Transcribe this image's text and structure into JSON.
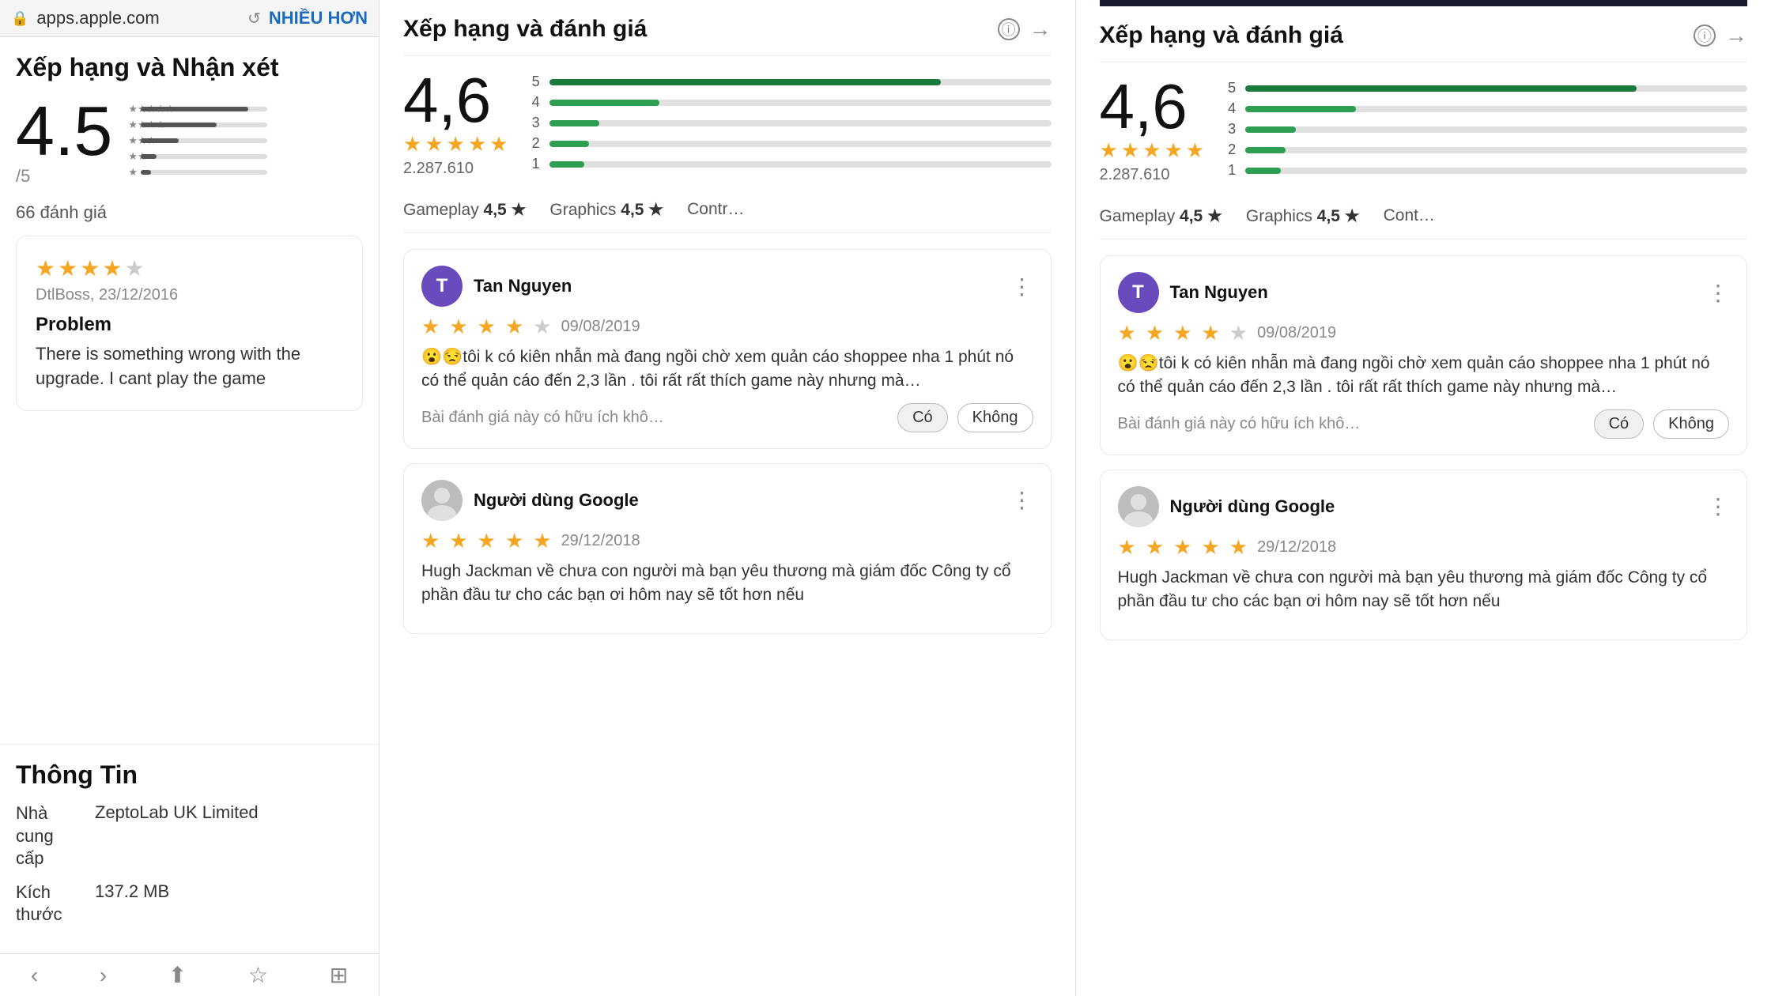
{
  "left": {
    "address_bar": {
      "url": "apps.apple.com",
      "more_btn": "NHIỀU HƠN"
    },
    "ratings_title": "Xếp hạng và Nhận xét",
    "big_rating": "4.5",
    "out_of": "/5",
    "review_count": "66 đánh giá",
    "stars": [
      {
        "level": 5,
        "width_pct": 85
      },
      {
        "level": 4,
        "width_pct": 65
      },
      {
        "level": 3,
        "width_pct": 40
      },
      {
        "level": 2,
        "width_pct": 15
      },
      {
        "level": 1,
        "width_pct": 8
      }
    ],
    "review": {
      "stars": 4,
      "author": "DtlBoss, 23/12/2016",
      "title": "Problem",
      "body": "There is something wrong with the upgrade. I cant play the game"
    },
    "info_section": {
      "title": "Thông Tin",
      "rows": [
        {
          "label": "Nhà cung cấp",
          "value": "ZeptoLab UK Limited"
        },
        {
          "label": "Kích thước",
          "value": "137.2 MB"
        }
      ]
    }
  },
  "middle": {
    "header_title": "Xếp hạng và đánh giá",
    "big_score": "4,6",
    "ratings_count": "2.287.610",
    "bars": [
      {
        "level": 5,
        "width_pct": 78
      },
      {
        "level": 4,
        "width_pct": 22
      },
      {
        "level": 3,
        "width_pct": 10
      },
      {
        "level": 2,
        "width_pct": 8
      },
      {
        "level": 1,
        "width_pct": 7
      }
    ],
    "categories": [
      {
        "label": "Gameplay",
        "score": "4,5 ★"
      },
      {
        "label": "Graphics",
        "score": "4,5 ★"
      },
      {
        "label": "Contr…",
        "score": ""
      }
    ],
    "reviews": [
      {
        "type": "initial",
        "avatar_letter": "T",
        "avatar_color": "purple",
        "name": "Tan Nguyen",
        "stars": 3.5,
        "date": "09/08/2019",
        "text": "😮😒tôi k có kiên nhẫn mà đang ngồi chờ xem quản cáo shoppee nha 1 phút nó có thể quản cáo đến 2,3 lần . tôi rất rất thích game này nhưng mà…",
        "helpful_text": "Bài đánh giá này có hữu ích khô…",
        "helpful_yes": "Có",
        "helpful_no": "Không"
      },
      {
        "type": "google",
        "name": "Người dùng Google",
        "stars": 5,
        "date": "29/12/2018",
        "text": "Hugh Jackman về chưa con người mà bạn yêu thương mà giám đốc Công ty cổ phần đầu tư cho các bạn ơi hôm nay sẽ tốt hơn nếu",
        "helpful_text": "",
        "helpful_yes": "",
        "helpful_no": ""
      }
    ]
  },
  "right": {
    "header_title": "Xếp hạng và đánh giá",
    "big_score": "4,6",
    "ratings_count": "2.287.610",
    "bars": [
      {
        "level": 5,
        "width_pct": 78
      },
      {
        "level": 4,
        "width_pct": 22
      },
      {
        "level": 3,
        "width_pct": 10
      },
      {
        "level": 2,
        "width_pct": 8
      },
      {
        "level": 1,
        "width_pct": 7
      }
    ],
    "categories": [
      {
        "label": "Gameplay",
        "score": "4,5 ★"
      },
      {
        "label": "Graphics",
        "score": "4,5 ★"
      },
      {
        "label": "Cont…",
        "score": ""
      }
    ],
    "reviews": [
      {
        "type": "initial",
        "avatar_letter": "T",
        "avatar_color": "purple",
        "name": "Tan Nguyen",
        "stars": 3.5,
        "date": "09/08/2019",
        "text": "😮😒tôi k có kiên nhẫn mà đang ngồi chờ xem quản cáo shoppee nha 1 phút nó có thể quản cáo đến 2,3 lần . tôi rất rất thích game này nhưng mà…",
        "helpful_text": "Bài đánh giá này có hữu ích khô…",
        "helpful_yes": "Có",
        "helpful_no": "Không"
      },
      {
        "type": "google",
        "name": "Người dùng Google",
        "stars": 5,
        "date": "29/12/2018",
        "text": "Hugh Jackman về chưa con người mà bạn yêu thương mà giám đốc Công ty cổ phần đầu tư cho các bạn ơi hôm nay sẽ tốt hơn nếu",
        "helpful_text": "",
        "helpful_yes": "",
        "helpful_no": ""
      }
    ]
  },
  "colors": {
    "green_dark": "#1a7a3c",
    "green_mid": "#2e9e52",
    "star_gold": "#f5a623",
    "purple_avatar": "#6a4bbd"
  }
}
